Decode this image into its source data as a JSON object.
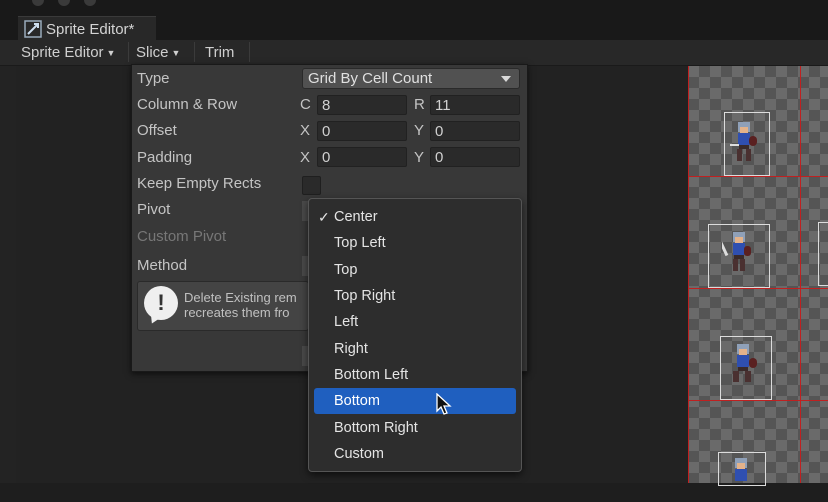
{
  "window": {
    "tab_title": "Sprite Editor*"
  },
  "toolbar": {
    "sprite_editor_label": "Sprite Editor",
    "slice_label": "Slice",
    "trim_label": "Trim"
  },
  "slice_panel": {
    "type_label": "Type",
    "type_value": "Grid By Cell Count",
    "column_row_label": "Column & Row",
    "c_label": "C",
    "c_value": "8",
    "r_label": "R",
    "r_value": "11",
    "offset_label": "Offset",
    "offset_x_label": "X",
    "offset_x_value": "0",
    "offset_y_label": "Y",
    "offset_y_value": "0",
    "padding_label": "Padding",
    "padding_x_label": "X",
    "padding_x_value": "0",
    "padding_y_label": "Y",
    "padding_y_value": "0",
    "keep_empty_rects_label": "Keep Empty Rects",
    "pivot_label": "Pivot",
    "custom_pivot_label": "Custom Pivot",
    "method_label": "Method",
    "help_line1": "Delete Existing rem",
    "help_line2": "recreates them fro"
  },
  "pivot_menu": {
    "selected": "Center",
    "highlighted": "Bottom",
    "items": [
      "Center",
      "Top Left",
      "Top",
      "Top Right",
      "Left",
      "Right",
      "Bottom Left",
      "Bottom",
      "Bottom Right",
      "Custom"
    ]
  },
  "colors": {
    "accent": "#1f5fbf",
    "slice_line": "#c02020",
    "panel_bg": "#383838"
  }
}
